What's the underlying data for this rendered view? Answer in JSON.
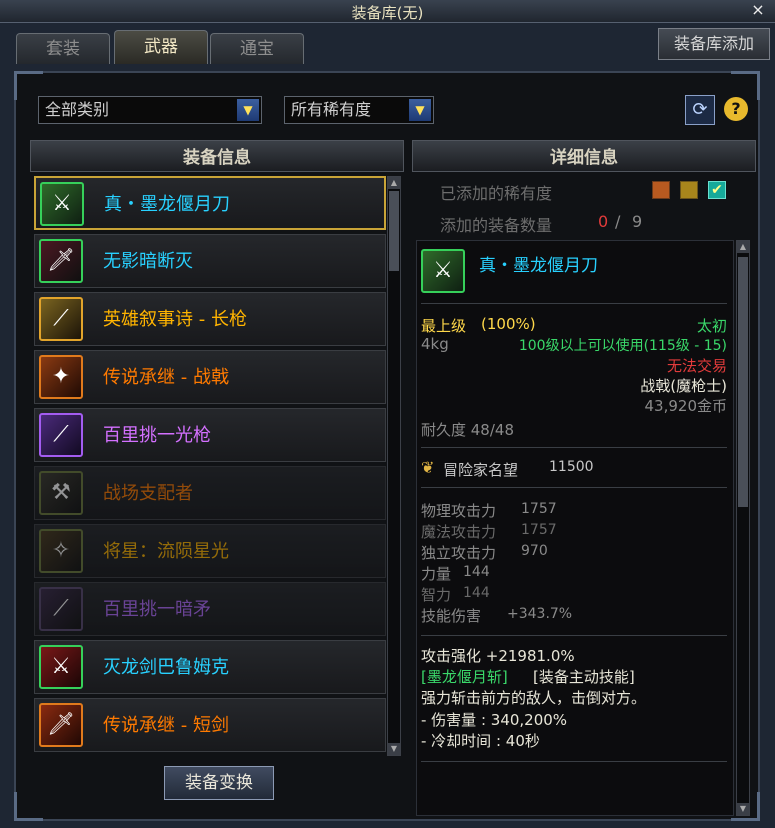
{
  "window": {
    "title": "装备库(无)",
    "close": "×"
  },
  "tabs": [
    {
      "label": "套装"
    },
    {
      "label": "武器"
    },
    {
      "label": "通宝"
    }
  ],
  "add_library_button": "装备库添加",
  "filters": {
    "category": "全部类别",
    "rarity": "所有稀有度"
  },
  "left_panel": {
    "header": "装备信息"
  },
  "items": [
    {
      "name": "真・墨龙偃月刀",
      "rarity": "sp",
      "icon": "dragon-blade-icon",
      "color": "#28d1ff"
    },
    {
      "name": "无影暗断灭",
      "rarity": "sp",
      "icon": "dark-blade-icon",
      "color": "#28d1ff"
    },
    {
      "name": "英雄叙事诗 - 长枪",
      "rarity": "epic",
      "icon": "spear-icon",
      "color": "#ffb400"
    },
    {
      "name": "传说承继 - 战戟",
      "rarity": "legendary",
      "icon": "halberd-icon",
      "color": "#ff7a00"
    },
    {
      "name": "百里挑一光枪",
      "rarity": "unique",
      "icon": "light-lance-icon",
      "color": "#d470ff"
    },
    {
      "name": "战场支配者",
      "rarity": "legendary",
      "icon": "battle-axe-icon",
      "color": "#ff7a00"
    },
    {
      "name": "将星：流陨星光",
      "rarity": "epic",
      "icon": "star-spear-icon",
      "color": "#ffb400"
    },
    {
      "name": "百里挑一暗矛",
      "rarity": "unique",
      "icon": "dark-spear-icon",
      "color": "#b36cff"
    },
    {
      "name": "灭龙剑巴鲁姆克",
      "rarity": "sp",
      "icon": "dragon-sword-icon",
      "color": "#28d1ff"
    },
    {
      "name": "传说承继 - 短剑",
      "rarity": "legendary",
      "icon": "short-sword-icon",
      "color": "#ff7a00"
    }
  ],
  "convert_button": "装备变换",
  "right_panel": {
    "header": "详细信息",
    "added_rarity_label": "已添加的稀有度",
    "added_count_label": "添加的装备数量",
    "added_count_current": "0",
    "added_count_sep": "/",
    "added_count_max": "9"
  },
  "detail": {
    "name": "真・墨龙偃月刀",
    "grade": "最上级",
    "grade_pct": "(100%)",
    "tier": "太初",
    "weight": "4kg",
    "level_req": "100级以上可以使用(115级 - 15)",
    "trade": "无法交易",
    "type": "战戟(魔枪士)",
    "price": "43,920金币",
    "durability": "耐久度 48/48",
    "fame_label": "冒险家名望",
    "fame_value": "11500",
    "stats": [
      {
        "label": "物理攻击力",
        "value": "1757"
      },
      {
        "label": "魔法攻击力",
        "value": "1757"
      },
      {
        "label": "独立攻击力",
        "value": "970"
      },
      {
        "label": "力量",
        "value": "144"
      },
      {
        "label": "智力",
        "value": "144"
      },
      {
        "label": "技能伤害",
        "value": "+343.7%"
      }
    ],
    "reinforce": "攻击强化 +21981.0%",
    "skill_name": "[墨龙偃月斩]",
    "skill_tag": "[装备主动技能]",
    "skill_desc": "强力斩击前方的敌人，击倒对方。",
    "skill_dmg": "- 伤害量 : 340,200%",
    "skill_cd": "- 冷却时间 : 40秒"
  },
  "colors": {
    "sp": "#28d1ff",
    "epic": "#ffb400",
    "legendary": "#ff7a00",
    "unique": "#d470ff",
    "selected_border": "#c9a437"
  }
}
